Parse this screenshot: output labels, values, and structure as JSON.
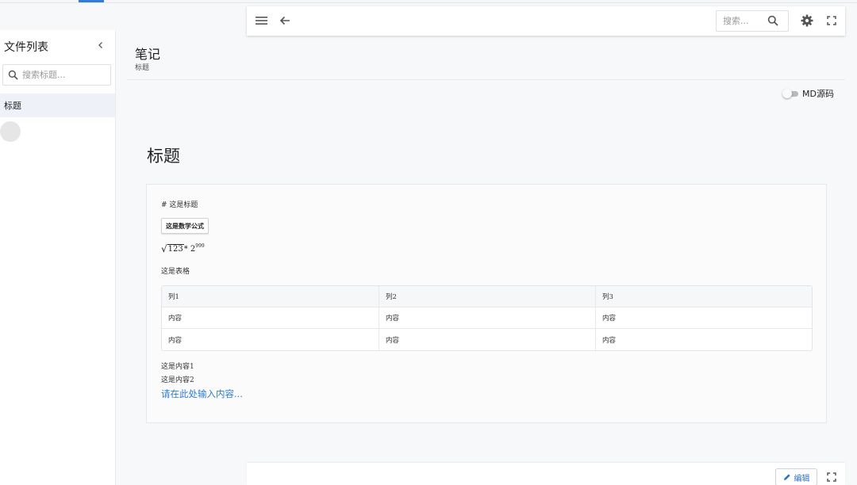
{
  "sidebar": {
    "title": "文件列表",
    "search_placeholder": "搜索标题...",
    "files": [
      {
        "label": "标题"
      }
    ]
  },
  "toolbar": {
    "search_placeholder": "搜索...",
    "icons": [
      "menu-icon",
      "back-arrow-icon",
      "search-icon",
      "gear-icon",
      "fullscreen-icon"
    ]
  },
  "page": {
    "title": "笔记",
    "subtitle": "标题",
    "md_toggle_label": "MD源码",
    "md_toggle_on": false
  },
  "document": {
    "title": "标题",
    "md_heading": "# 这是标题",
    "formula_button": "这是数学公式",
    "formula": {
      "radicand": "123",
      "operator": " * 2",
      "exponent": "999"
    },
    "table_caption": "这是表格",
    "table": {
      "headers": [
        "列1",
        "列2",
        "列3"
      ],
      "rows": [
        [
          "内容",
          "内容",
          "内容"
        ],
        [
          "内容",
          "内容",
          "内容"
        ]
      ]
    },
    "content_lines": [
      "这是内容1",
      "这是内容2"
    ],
    "input_prompt": "请在此处输入内容..."
  },
  "bottom_bar": {
    "edit_label": "编辑"
  },
  "colors": {
    "accent": "#2f7dd6",
    "link": "#2d7bd2",
    "selected_item_bg": "#eef1f8"
  }
}
